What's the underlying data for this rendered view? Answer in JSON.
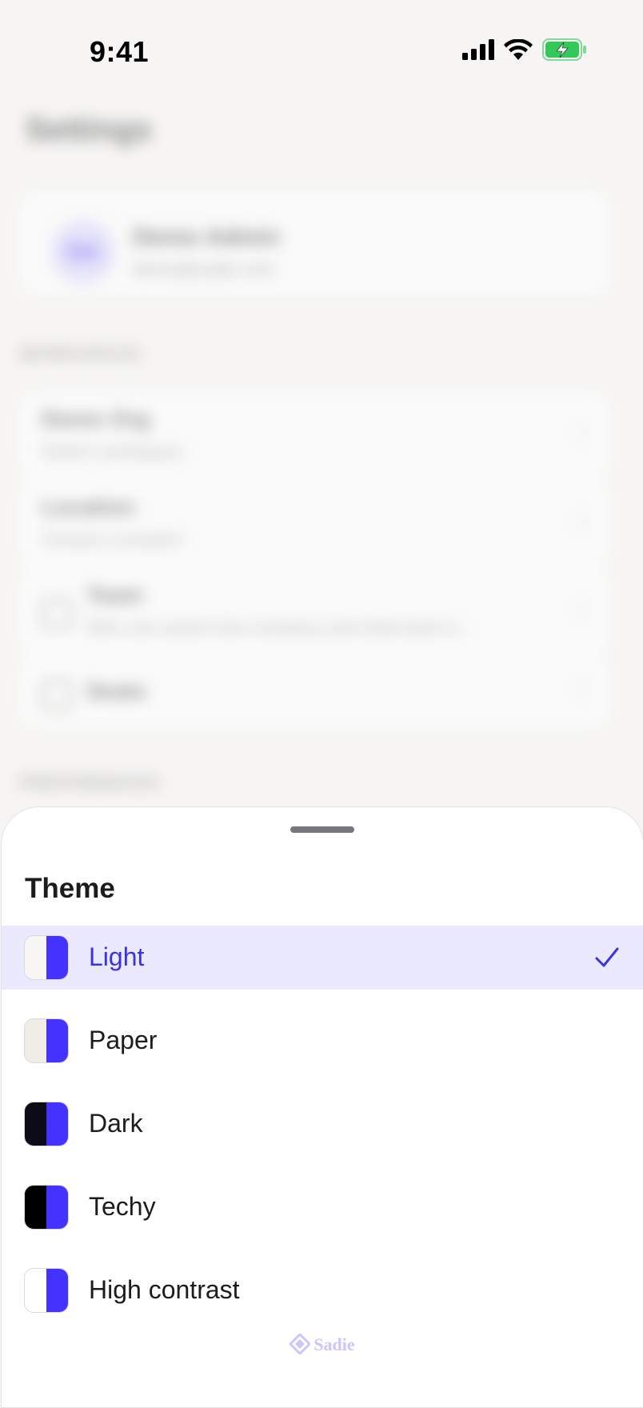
{
  "status_bar": {
    "time": "9:41",
    "icons": [
      "signal-icon",
      "wifi-icon",
      "battery-charging-icon"
    ]
  },
  "background": {
    "title": "Settings",
    "profile": {
      "initials": "DA",
      "name": "Demo Admin",
      "subtitle": "demo@sadie.com"
    },
    "section1_label": "WORKSPACE",
    "rows": [
      {
        "title": "Demo Org",
        "subtitle": "Switch workspace"
      },
      {
        "title": "Location",
        "subtitle": "Choose a location"
      },
      {
        "title": "Team",
        "subtitle": "Who can search this company and what team it..."
      },
      {
        "title": "Seats"
      }
    ],
    "section2_label": "PREFERENCES"
  },
  "sheet": {
    "title": "Theme",
    "selected_check": "checkmark-icon",
    "themes": [
      {
        "label": "Light",
        "left_color": "#f7f6f5",
        "selected": true
      },
      {
        "label": "Paper",
        "left_color": "#f0ede6",
        "selected": false
      },
      {
        "label": "Dark",
        "left_color": "#0c0b17",
        "selected": false
      },
      {
        "label": "Techy",
        "left_color": "#000000",
        "selected": false
      },
      {
        "label": "High contrast",
        "left_color": "#ffffff",
        "selected": false
      }
    ],
    "accent_color": "#4433ff",
    "brand": "Sadie"
  }
}
